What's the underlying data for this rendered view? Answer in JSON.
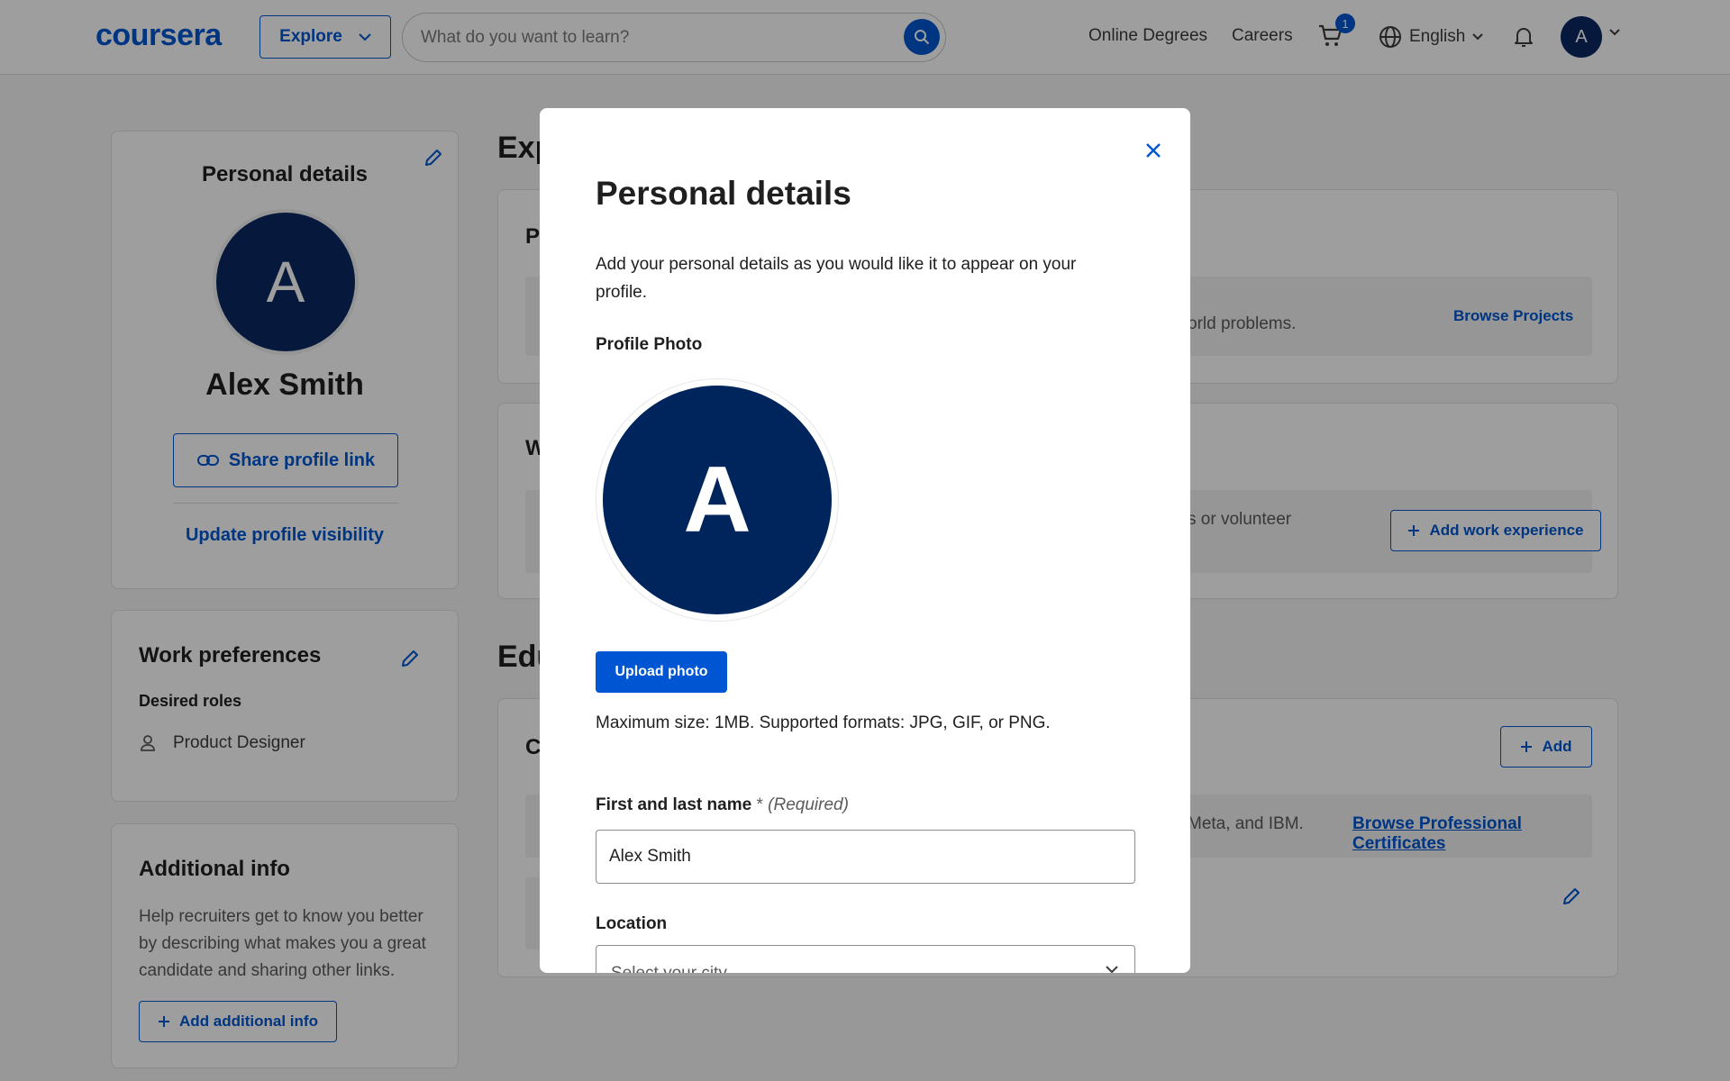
{
  "header": {
    "logo": "coursera",
    "explore_label": "Explore",
    "search_placeholder": "What do you want to learn?",
    "nav": [
      "Online Degrees",
      "Careers"
    ],
    "cart_count": "1",
    "language": "English",
    "user_initial": "A"
  },
  "sidebar": {
    "personal": {
      "title": "Personal details",
      "initial": "A",
      "name": "Alex Smith",
      "share_label": "Share profile link",
      "visibility_label": "Update profile visibility"
    },
    "work_prefs": {
      "title": "Work preferences",
      "desired_roles_label": "Desired roles",
      "role": "Product Designer"
    },
    "additional": {
      "title": "Additional info",
      "description": "Help recruiters get to know you better by describing what makes you a great candidate and sharing other links.",
      "add_label": "Add additional info"
    }
  },
  "main": {
    "experience_heading": "Exp",
    "projects_card": {
      "title_fragment": "P",
      "text_fragment": "orld problems.",
      "link": "Browse Projects"
    },
    "work_card": {
      "title_fragment": "W",
      "text_fragment": "s or volunteer",
      "button": "Add work experience"
    },
    "education_heading": "Edu",
    "education_card": {
      "title_fragment": "C",
      "add_label": "Add",
      "text_fragment": "Meta, and IBM.",
      "link": "Browse Professional Certificates"
    }
  },
  "modal": {
    "title": "Personal details",
    "description": "Add your personal details as you would like it to appear on your profile.",
    "photo_label": "Profile Photo",
    "photo_initial": "A",
    "upload_label": "Upload photo",
    "size_note": "Maximum size: 1MB. Supported formats: JPG, GIF, or PNG.",
    "name_label": "First and last name",
    "name_required": "*",
    "name_required_text": "(Required)",
    "name_value": "Alex Smith",
    "location_label": "Location",
    "location_placeholder": "Select your city"
  },
  "colors": {
    "brand": "#0056d2",
    "avatar_dark": "#0b2962",
    "modal_avatar": "#00255d"
  },
  "icons": [
    "search-icon",
    "chevron-down-icon",
    "cart-icon",
    "globe-icon",
    "bell-icon",
    "edit-icon",
    "link-icon",
    "person-icon",
    "plus-icon",
    "close-icon"
  ]
}
